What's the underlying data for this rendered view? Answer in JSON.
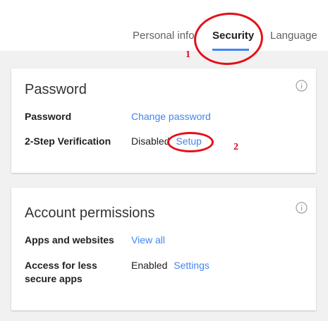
{
  "tabs": [
    {
      "label": "Personal info",
      "active": false
    },
    {
      "label": "Security",
      "active": true
    },
    {
      "label": "Language",
      "active": false
    }
  ],
  "annotations": {
    "marker_1": "1",
    "marker_2": "2",
    "color": "#e3101a"
  },
  "accent_color": "#4285f4",
  "password_card": {
    "title": "Password",
    "info_icon": "info-icon",
    "rows": [
      {
        "label": "Password",
        "value": "",
        "link": "Change password"
      },
      {
        "label": "2-Step Verification",
        "value": "Disabled",
        "link": "Setup"
      }
    ]
  },
  "permissions_card": {
    "title": "Account permissions",
    "info_icon": "info-icon",
    "rows": [
      {
        "label": "Apps and websites",
        "value": "",
        "link": "View all"
      },
      {
        "label_line1": "Access for less",
        "label_line2": "secure apps",
        "value": "Enabled",
        "link": "Settings"
      }
    ]
  }
}
